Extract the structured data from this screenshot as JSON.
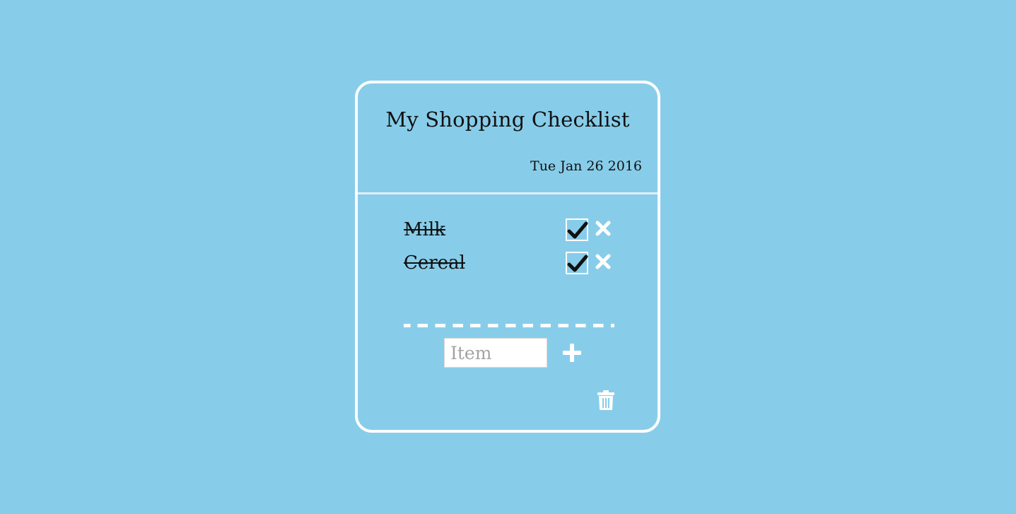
{
  "checklist": {
    "title": "My Shopping Checklist",
    "date": "Tue Jan 26 2016",
    "items": [
      {
        "label": "Milk",
        "checked": true
      },
      {
        "label": "Cereal",
        "checked": true
      }
    ],
    "new_item": {
      "placeholder": "Item",
      "value": ""
    }
  },
  "icons": {
    "check": "check-icon",
    "remove": "close-icon",
    "add": "plus-icon",
    "clear": "trash-icon"
  },
  "colors": {
    "background": "#87cdea",
    "card_border": "#ffffff",
    "text": "#111111",
    "placeholder": "#a3a3a3"
  }
}
